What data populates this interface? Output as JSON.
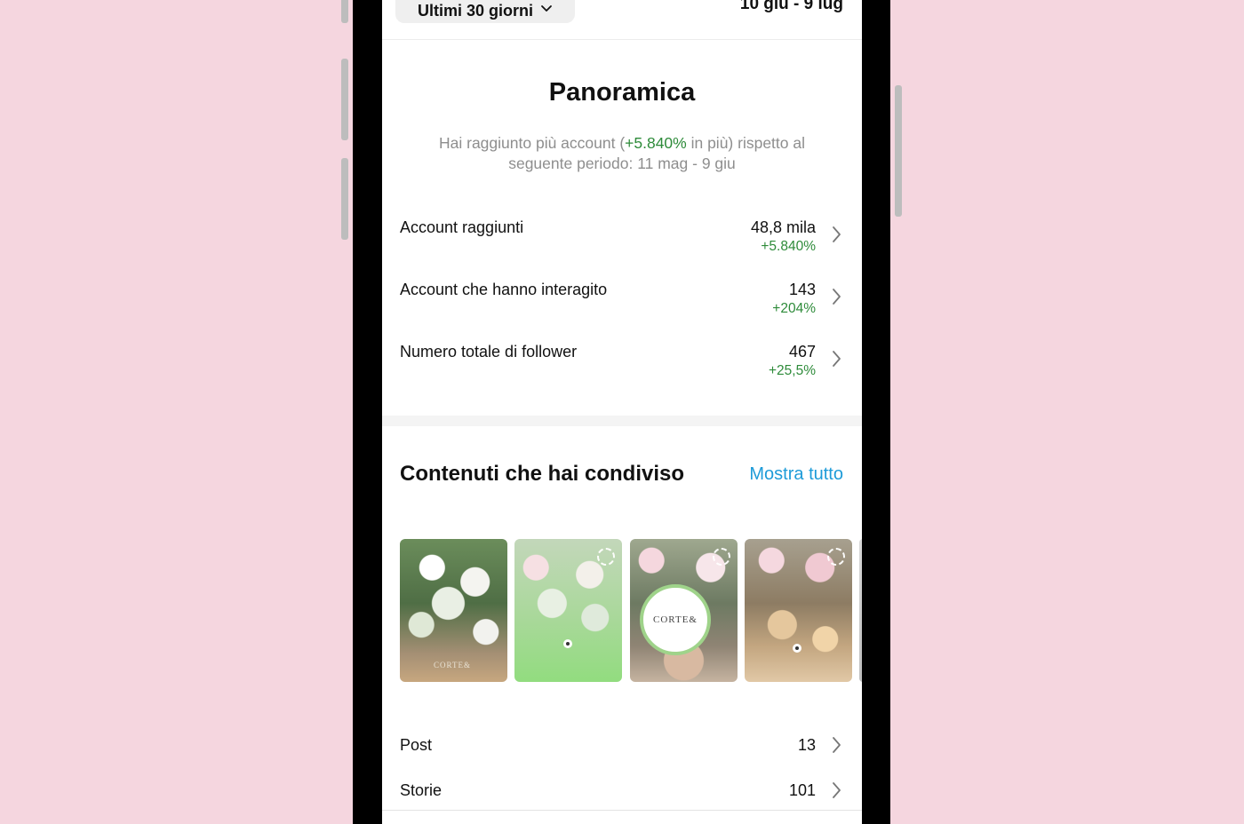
{
  "header": {
    "range_label": "Ultimi 30 giorni",
    "date_range": "10 giu - 9 lug"
  },
  "overview": {
    "title": "Panoramica",
    "subtitle_part1": "Hai raggiunto più account (",
    "subtitle_highlight": "+5.840%",
    "subtitle_part2": " in più) rispetto al seguente periodo: 11 mag - 9 giu",
    "metrics": [
      {
        "label": "Account raggiunti",
        "value": "48,8 mila",
        "delta": "+5.840%"
      },
      {
        "label": "Account che hanno interagito",
        "value": "143",
        "delta": "+204%"
      },
      {
        "label": "Numero totale di follower",
        "value": "467",
        "delta": "+25,5%"
      }
    ]
  },
  "content": {
    "title": "Contenuti che hai condiviso",
    "see_all": "Mostra tutto",
    "thumb_logo_text": "CORTE&",
    "rows": [
      {
        "label": "Post",
        "value": "13"
      },
      {
        "label": "Storie",
        "value": "101"
      }
    ]
  },
  "colors": {
    "background": "#f5d6df",
    "positive": "#2e8b3a",
    "link": "#1d9bd8"
  }
}
